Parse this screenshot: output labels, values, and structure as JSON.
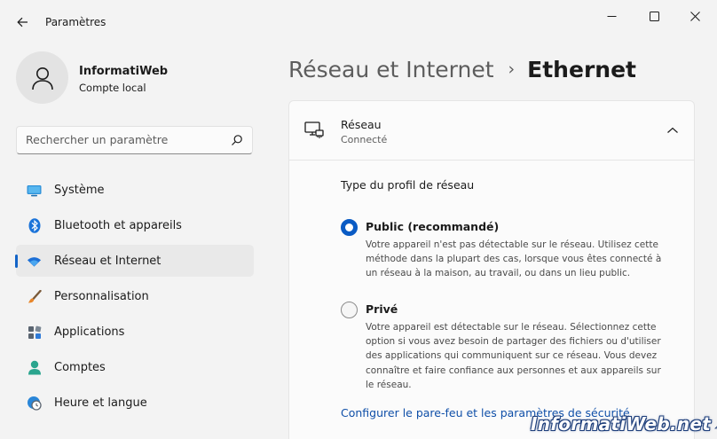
{
  "window": {
    "app_title": "Paramètres"
  },
  "profile": {
    "name": "InformatiWeb",
    "account_type": "Compte local"
  },
  "search": {
    "placeholder": "Rechercher un paramètre"
  },
  "sidebar": {
    "items": [
      {
        "label": "Système",
        "icon": "system-display-icon",
        "active": false
      },
      {
        "label": "Bluetooth et appareils",
        "icon": "bluetooth-icon",
        "active": false
      },
      {
        "label": "Réseau et Internet",
        "icon": "wifi-icon",
        "active": true
      },
      {
        "label": "Personnalisation",
        "icon": "paintbrush-icon",
        "active": false
      },
      {
        "label": "Applications",
        "icon": "apps-icon",
        "active": false
      },
      {
        "label": "Comptes",
        "icon": "person-icon",
        "active": false
      },
      {
        "label": "Heure et langue",
        "icon": "clock-globe-icon",
        "active": false
      }
    ]
  },
  "breadcrumb": {
    "parent": "Réseau et Internet",
    "separator": "›",
    "current": "Ethernet"
  },
  "network_card": {
    "title": "Réseau",
    "status": "Connecté",
    "expanded": true,
    "profile_type_title": "Type du profil de réseau",
    "options": [
      {
        "label": "Public (recommandé)",
        "checked": true,
        "description": "Votre appareil n'est pas détectable sur le réseau. Utilisez cette méthode dans la plupart des cas, lorsque vous êtes connecté à un réseau à la maison, au travail, ou dans un lieu public."
      },
      {
        "label": "Privé",
        "checked": false,
        "description": "Votre appareil est détectable sur le réseau. Sélectionnez cette option si vous avez besoin de partager des fichiers ou d'utiliser des applications qui communiquent sur ce réseau. Vous devez connaître et faire confiance aux personnes et aux appareils sur le réseau."
      }
    ],
    "firewall_link": "Configurer le pare-feu et les paramètres de sécurité"
  },
  "watermark": {
    "text": "InformatiWeb.net"
  },
  "colors": {
    "accent": "#0a5bc4",
    "link": "#0f4fa8",
    "background": "#f3f3f3",
    "card": "#fbfbfb"
  }
}
